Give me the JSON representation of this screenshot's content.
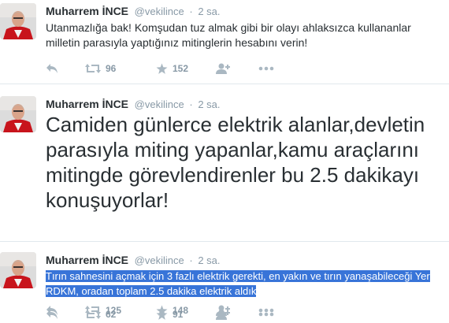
{
  "tweets": [
    {
      "name": "Muharrem İNCE",
      "handle": "@vekilince",
      "separator": "·",
      "time": "2 sa.",
      "text": "Utanmazlığa bak! Komşudan tuz almak gibi bir olayı ahlaksızca kullananlar milletin parasıyla yaptığınız mitinglerin hesabını verin!",
      "retweets": "96",
      "favorites": "152"
    },
    {
      "name": "Muharrem İNCE",
      "handle": "@vekilince",
      "separator": "·",
      "time": "2 sa.",
      "text": "Camiden günlerce elektrik alanlar,devletin parasıyla miting yapanlar,kamu araçlarını mitingde görevlendirenler bu 2.5 dakikayı konuşuyorlar!",
      "retweets": "125",
      "favorites": "148"
    },
    {
      "name": "Muharrem İNCE",
      "handle": "@vekilince",
      "separator": "·",
      "time": "2 sa.",
      "text_selected": "Tırın sahnesini açmak için 3 fazlı elektrik gerekti, en yakın ve tırın yanaşabileceği Yer RDKM, oradan toplam 2.5 dakika elektrik aldık",
      "retweets": "62",
      "favorites": "91"
    }
  ],
  "icons": {
    "reply": "reply-icon",
    "retweet": "retweet-icon",
    "favorite": "star-icon",
    "follow": "follow-icon",
    "more": "more-icon"
  },
  "colors": {
    "icon_gray": "#aab8c2",
    "meta_gray": "#8899a6",
    "selection": "#3874d8",
    "avatar_bg": "#d9d9d9"
  }
}
